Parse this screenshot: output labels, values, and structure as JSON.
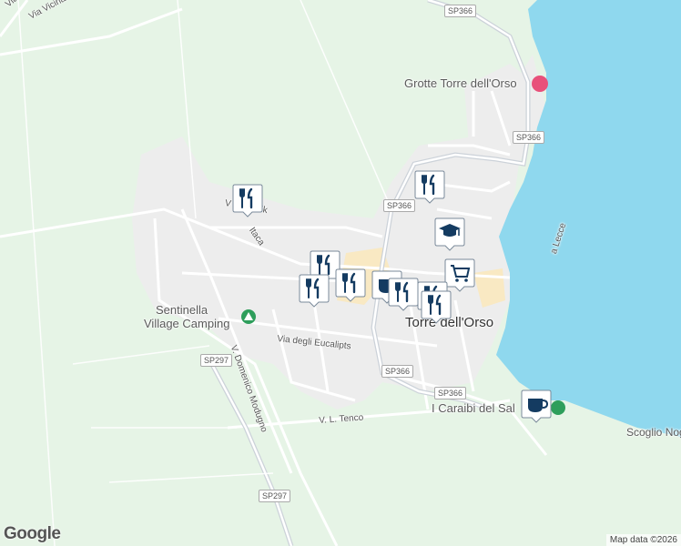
{
  "map": {
    "colors": {
      "land": "#e6f4e6",
      "urban": "#ededed",
      "sea": "#8fd8ee",
      "road": "#ffffff",
      "major_road": "#d0d5dc",
      "highlight": "#fbe7b8",
      "pin_fill": "#ffffff",
      "pin_icon": "#143b61"
    },
    "labels": {
      "grotte": "Grotte Torre dell'Orso",
      "sentinella_1": "Sentinella",
      "sentinella_2": "Village Camping",
      "town": "Torre dell'Orso",
      "caraibi": "I Caraibi del Sal",
      "scoglio": "Scoglio Nog"
    },
    "roads": {
      "via_vicinale": "Via Vicinale Mar",
      "via_dell": "Via dell",
      "via_eucalipts": "Via degli Eucalipts",
      "v_domenico": "V. Domenico Modugno",
      "v_tenco": "V. L. Tenco",
      "v_lecce": "a Lecce",
      "v_ubrovnik": "V   ubrovnik",
      "v_itaca": "Itaca"
    },
    "shields": {
      "sp366_top": "SP366",
      "sp366_right": "SP366",
      "sp366_mid": "SP366",
      "sp366_low1": "SP366",
      "sp366_low2": "SP366",
      "sp297_left": "SP297",
      "sp297_bottom": "SP297"
    },
    "markers": [
      {
        "name": "restaurant",
        "icon": "utensils-icon"
      },
      {
        "name": "restaurant",
        "icon": "utensils-icon"
      },
      {
        "name": "school",
        "icon": "graduation-cap-icon"
      },
      {
        "name": "restaurant",
        "icon": "utensils-icon"
      },
      {
        "name": "restaurant",
        "icon": "utensils-icon"
      },
      {
        "name": "restaurant",
        "icon": "utensils-icon"
      },
      {
        "name": "shop",
        "icon": "cart-icon"
      },
      {
        "name": "cafe",
        "icon": "coffee-cup-icon"
      },
      {
        "name": "restaurant",
        "icon": "utensils-icon"
      },
      {
        "name": "restaurant",
        "icon": "utensils-icon"
      },
      {
        "name": "restaurant",
        "icon": "utensils-icon"
      },
      {
        "name": "cafe",
        "icon": "coffee-cup-icon"
      }
    ],
    "footer": {
      "brand": "Google",
      "data": "Map data ©2026"
    }
  }
}
